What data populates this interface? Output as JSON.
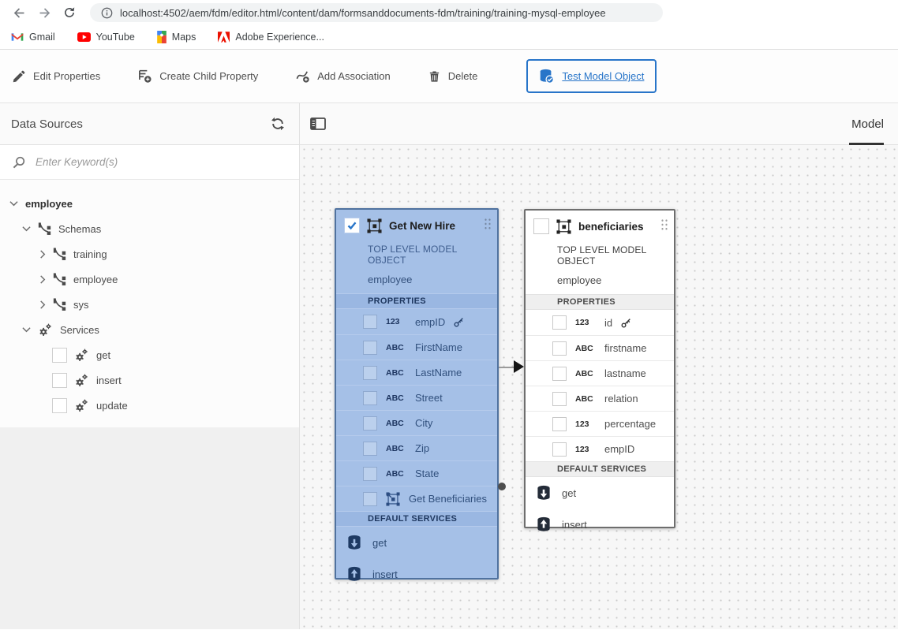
{
  "browser": {
    "url": "localhost:4502/aem/fdm/editor.html/content/dam/formsanddocuments-fdm/training/training-mysql-employee",
    "bookmarks": [
      {
        "label": "Gmail"
      },
      {
        "label": "YouTube"
      },
      {
        "label": "Maps"
      },
      {
        "label": "Adobe Experience..."
      }
    ]
  },
  "toolbar": {
    "edit_properties": "Edit Properties",
    "create_child_property": "Create Child Property",
    "add_association": "Add Association",
    "delete": "Delete",
    "test_model_object": "Test Model Object"
  },
  "panel": {
    "title": "Data Sources",
    "search_placeholder": "Enter Keyword(s)",
    "tree": [
      {
        "label": "employee"
      },
      {
        "label": "Schemas"
      },
      {
        "label": "training"
      },
      {
        "label": "employee"
      },
      {
        "label": "sys"
      },
      {
        "label": "Services"
      },
      {
        "label": "get"
      },
      {
        "label": "insert"
      },
      {
        "label": "update"
      }
    ]
  },
  "canvas": {
    "tab": "Model",
    "cards": [
      {
        "title": "Get New Hire",
        "selected": true,
        "type_label": "TOP LEVEL MODEL OBJECT",
        "source": "employee",
        "properties_header": "PROPERTIES",
        "services_header": "DEFAULT SERVICES",
        "properties": [
          {
            "type": "123",
            "name": "empID",
            "primary_key": true
          },
          {
            "type": "ABC",
            "name": "FirstName"
          },
          {
            "type": "ABC",
            "name": "LastName"
          },
          {
            "type": "ABC",
            "name": "Street"
          },
          {
            "type": "ABC",
            "name": "City"
          },
          {
            "type": "ABC",
            "name": "Zip"
          },
          {
            "type": "ABC",
            "name": "State"
          },
          {
            "type": "model",
            "name": "Get Beneficiaries"
          }
        ],
        "services": [
          {
            "name": "get"
          },
          {
            "name": "insert"
          }
        ]
      },
      {
        "title": "beneficiaries",
        "selected": false,
        "type_label": "TOP LEVEL MODEL OBJECT",
        "source": "employee",
        "properties_header": "PROPERTIES",
        "services_header": "DEFAULT SERVICES",
        "properties": [
          {
            "type": "123",
            "name": "id",
            "primary_key": true
          },
          {
            "type": "ABC",
            "name": "firstname"
          },
          {
            "type": "ABC",
            "name": "lastname"
          },
          {
            "type": "ABC",
            "name": "relation"
          },
          {
            "type": "123",
            "name": "percentage"
          },
          {
            "type": "123",
            "name": "empID"
          }
        ],
        "services": [
          {
            "name": "get"
          },
          {
            "name": "insert"
          }
        ]
      }
    ]
  },
  "colors": {
    "accent_blue": "#2875c9",
    "selected_card_bg": "#a5c0e7",
    "selected_card_border": "#50729f"
  }
}
